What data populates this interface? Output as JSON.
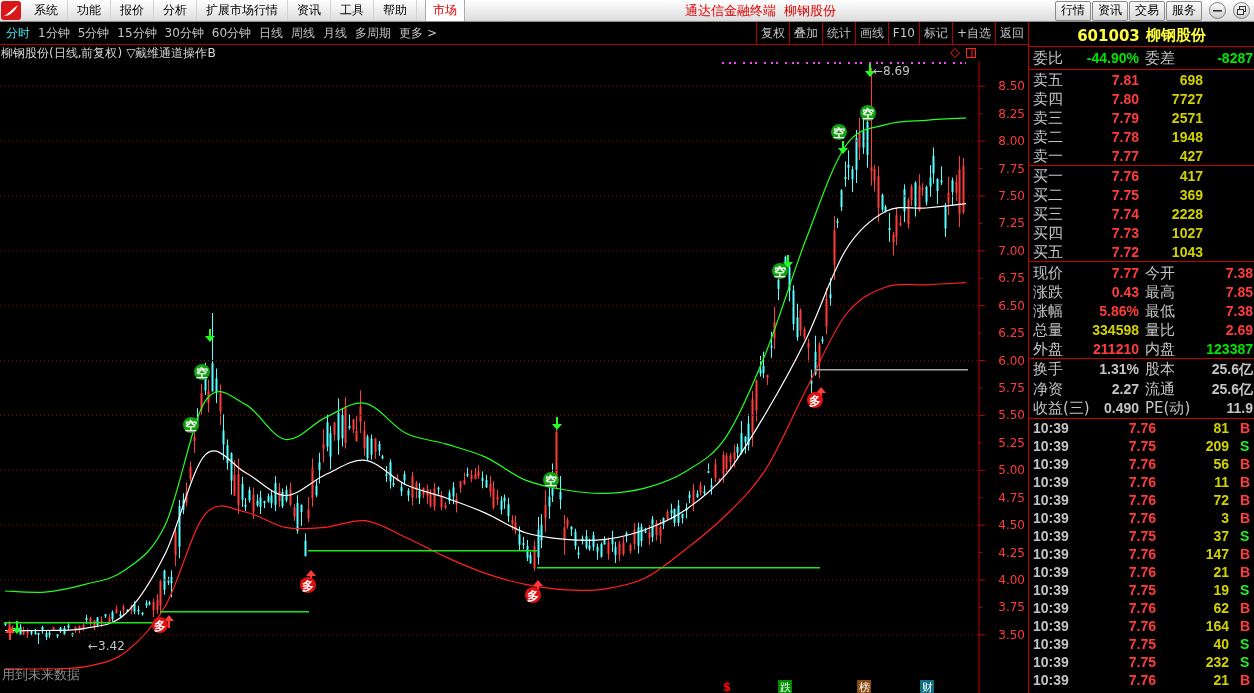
{
  "title_bar": {
    "menu": [
      "系统",
      "功能",
      "报价",
      "分析",
      "扩展市场行情",
      "资讯",
      "工具",
      "帮助"
    ],
    "market_tab": {
      "label": "市场",
      "selected": true
    },
    "app_name": "通达信金融终端",
    "stock_name": "柳钢股份",
    "buttons": [
      "行情",
      "资讯",
      "交易",
      "服务"
    ]
  },
  "period_tabs": [
    {
      "label": "分时",
      "selected": true
    },
    {
      "label": "1分钟",
      "selected": false
    },
    {
      "label": "5分钟",
      "selected": false
    },
    {
      "label": "15分钟",
      "selected": false
    },
    {
      "label": "30分钟",
      "selected": false
    },
    {
      "label": "60分钟",
      "selected": false
    },
    {
      "label": "日线",
      "selected": false
    },
    {
      "label": "周线",
      "selected": false
    },
    {
      "label": "月线",
      "selected": false
    },
    {
      "label": "多周期",
      "selected": false
    },
    {
      "label": "更多 >",
      "selected": false
    }
  ],
  "toolbar": [
    "复权",
    "叠加",
    "统计",
    "画线",
    "F10",
    "标记",
    "+自选",
    "返回"
  ],
  "chart": {
    "title": "柳钢股份(日线,前复权)",
    "indicator": "▽戴维通道操作B",
    "chart_data": {
      "type": "line",
      "grid": true,
      "ylim": [
        2.97,
        8.73
      ],
      "yticks": [
        {
          "value": 8.5,
          "label": "8.50"
        },
        {
          "value": 8.25,
          "label": "8.25"
        },
        {
          "value": 8.0,
          "label": "8.00"
        },
        {
          "value": 7.75,
          "label": "7.75"
        },
        {
          "value": 7.5,
          "label": "7.50"
        },
        {
          "value": 7.25,
          "label": "7.25"
        },
        {
          "value": 7.0,
          "label": "7.00"
        },
        {
          "value": 6.75,
          "label": "6.75"
        },
        {
          "value": 6.5,
          "label": "6.50"
        },
        {
          "value": 6.25,
          "label": "6.25"
        },
        {
          "value": 6.0,
          "label": "6.00"
        },
        {
          "value": 5.75,
          "label": "5.75"
        },
        {
          "value": 5.5,
          "label": "5.50"
        },
        {
          "value": 5.25,
          "label": "5.25"
        },
        {
          "value": 5.0,
          "label": "5.00"
        },
        {
          "value": 4.75,
          "label": "4.75"
        },
        {
          "value": 4.5,
          "label": "4.50"
        },
        {
          "value": 4.25,
          "label": "4.25"
        },
        {
          "value": 4.0,
          "label": "4.00"
        },
        {
          "value": 3.75,
          "label": "3.75"
        },
        {
          "value": 3.5,
          "label": "3.50"
        }
      ],
      "series": [
        {
          "color": "#22ff22",
          "values": [
            3.9,
            3.89,
            3.96,
            4.09,
            4.5,
            5.63,
            5.6,
            5.28,
            5.48,
            5.61,
            5.34,
            5.24,
            5.12,
            4.91,
            4.82,
            4.79,
            4.84,
            4.99,
            5.3,
            6.07,
            7.1,
            7.96,
            8.15,
            8.19,
            8.21
          ]
        },
        {
          "color": "#ffffff",
          "values": [
            3.54,
            3.54,
            3.56,
            3.69,
            4.24,
            5.14,
            4.98,
            4.77,
            4.96,
            5.09,
            4.87,
            4.75,
            4.61,
            4.43,
            4.37,
            4.37,
            4.46,
            4.64,
            4.96,
            5.52,
            6.19,
            7.01,
            7.36,
            7.39,
            7.43
          ]
        },
        {
          "color": "#ff2020",
          "values": [
            3.19,
            3.19,
            3.21,
            3.34,
            3.76,
            4.6,
            4.62,
            4.48,
            4.48,
            4.54,
            4.39,
            4.21,
            4.06,
            3.96,
            3.91,
            3.92,
            4.02,
            4.28,
            4.59,
            5.01,
            5.73,
            6.42,
            6.67,
            6.69,
            6.71
          ]
        }
      ]
    },
    "high_label": "←8.69",
    "low_label": "←3.42",
    "signals": [
      {
        "label": "多",
        "kind": "long"
      },
      {
        "label": "空",
        "kind": "short"
      },
      {
        "label": "空",
        "kind": "short"
      },
      {
        "label": "多",
        "kind": "long"
      },
      {
        "label": "多",
        "kind": "long"
      },
      {
        "label": "空",
        "kind": "short"
      },
      {
        "label": "空",
        "kind": "short"
      },
      {
        "label": "多",
        "kind": "long"
      },
      {
        "label": "空",
        "kind": "short"
      },
      {
        "label": "空",
        "kind": "short"
      }
    ],
    "note": "用到未来数据",
    "markers": [
      {
        "label": "$",
        "kind": "glyph",
        "color": "#ff0000"
      },
      {
        "label": "跌",
        "kind": "tile",
        "color": "#008a00"
      },
      {
        "label": "榜",
        "kind": "tile",
        "color": "#8a4a10"
      },
      {
        "label": "财",
        "kind": "tile",
        "color": "#106e80"
      }
    ]
  },
  "quote": {
    "code": "601003",
    "name": "柳钢股份",
    "ratio": [
      {
        "label": "委比",
        "value": "-44.90%",
        "color": "#00e600"
      },
      {
        "label": "委差",
        "value": "-8287",
        "color": "#00e600"
      }
    ],
    "asks": [
      {
        "label": "卖五",
        "price": "7.81",
        "volume": "698"
      },
      {
        "label": "卖四",
        "price": "7.80",
        "volume": "7727"
      },
      {
        "label": "卖三",
        "price": "7.79",
        "volume": "2571"
      },
      {
        "label": "卖二",
        "price": "7.78",
        "volume": "1948"
      },
      {
        "label": "卖一",
        "price": "7.77",
        "volume": "427"
      }
    ],
    "bids": [
      {
        "label": "买一",
        "price": "7.76",
        "volume": "417"
      },
      {
        "label": "买二",
        "price": "7.75",
        "volume": "369"
      },
      {
        "label": "买三",
        "price": "7.74",
        "volume": "2228"
      },
      {
        "label": "买四",
        "price": "7.73",
        "volume": "1027"
      },
      {
        "label": "买五",
        "price": "7.72",
        "volume": "1043"
      }
    ],
    "stats": [
      {
        "label": "现价",
        "value": "7.77",
        "color": "#ff3c3c"
      },
      {
        "label": "今开",
        "value": "7.38",
        "color": "#ff3c3c"
      },
      {
        "label": "涨跌",
        "value": "0.43",
        "color": "#ff3c3c"
      },
      {
        "label": "最高",
        "value": "7.85",
        "color": "#ff3c3c"
      },
      {
        "label": "涨幅",
        "value": "5.86%",
        "color": "#ff3c3c"
      },
      {
        "label": "最低",
        "value": "7.38",
        "color": "#ff3c3c"
      },
      {
        "label": "总量",
        "value": "334598",
        "color": "#d2d200"
      },
      {
        "label": "量比",
        "value": "2.69",
        "color": "#ff3c3c"
      },
      {
        "label": "外盘",
        "value": "211210",
        "color": "#ff3c3c"
      },
      {
        "label": "内盘",
        "value": "123387",
        "color": "#00e600"
      }
    ],
    "fundamentals": [
      {
        "label": "换手",
        "value": "1.31%"
      },
      {
        "label": "股本",
        "value": "25.6亿"
      },
      {
        "label": "净资",
        "value": "2.27"
      },
      {
        "label": "流通",
        "value": "25.6亿"
      },
      {
        "label": "收益(三)",
        "value": "0.490"
      },
      {
        "label": "PE(动)",
        "value": "11.9"
      }
    ],
    "trades": [
      {
        "time": "10:39",
        "price": "7.76",
        "volume": "81",
        "side": "B",
        "kind": "buy"
      },
      {
        "time": "10:39",
        "price": "7.75",
        "volume": "209",
        "side": "S",
        "kind": "sell"
      },
      {
        "time": "10:39",
        "price": "7.76",
        "volume": "56",
        "side": "B",
        "kind": "buy"
      },
      {
        "time": "10:39",
        "price": "7.76",
        "volume": "11",
        "side": "B",
        "kind": "buy"
      },
      {
        "time": "10:39",
        "price": "7.76",
        "volume": "72",
        "side": "B",
        "kind": "buy"
      },
      {
        "time": "10:39",
        "price": "7.76",
        "volume": "3",
        "side": "B",
        "kind": "buy"
      },
      {
        "time": "10:39",
        "price": "7.75",
        "volume": "37",
        "side": "S",
        "kind": "sell"
      },
      {
        "time": "10:39",
        "price": "7.76",
        "volume": "147",
        "side": "B",
        "kind": "buy"
      },
      {
        "time": "10:39",
        "price": "7.76",
        "volume": "21",
        "side": "B",
        "kind": "buy"
      },
      {
        "time": "10:39",
        "price": "7.75",
        "volume": "19",
        "side": "S",
        "kind": "sell"
      },
      {
        "time": "10:39",
        "price": "7.76",
        "volume": "62",
        "side": "B",
        "kind": "buy"
      },
      {
        "time": "10:39",
        "price": "7.76",
        "volume": "164",
        "side": "B",
        "kind": "buy"
      },
      {
        "time": "10:39",
        "price": "7.75",
        "volume": "40",
        "side": "S",
        "kind": "sell"
      },
      {
        "time": "10:39",
        "price": "7.75",
        "volume": "232",
        "side": "S",
        "kind": "sell"
      },
      {
        "time": "10:39",
        "price": "7.76",
        "volume": "21",
        "side": "B",
        "kind": "buy"
      }
    ]
  }
}
